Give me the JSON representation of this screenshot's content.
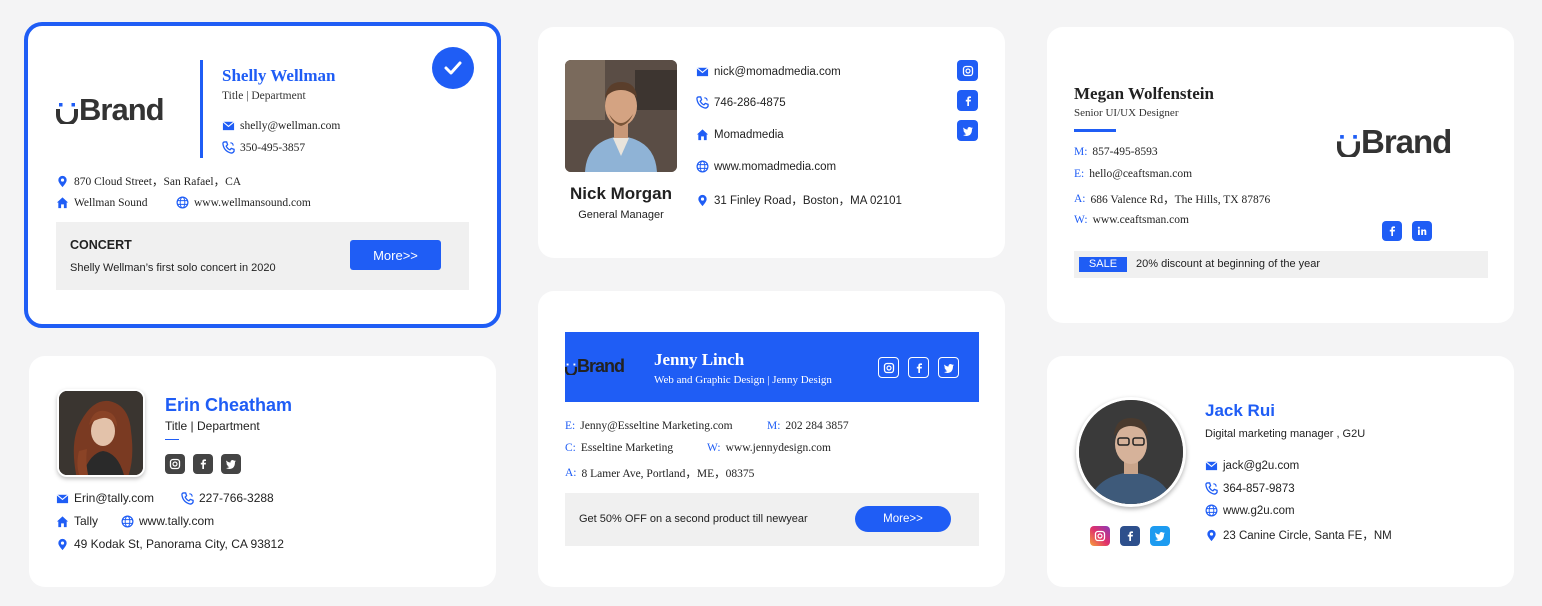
{
  "card1": {
    "brand": "Brand",
    "name": "Shelly Wellman",
    "title": "Title | Department",
    "email": "shelly@wellman.com",
    "phone": "350-495-3857",
    "address": "870 Cloud Street，San Rafael，CA",
    "company": "Wellman Sound",
    "website": "www.wellmansound.com",
    "banner_title": "CONCERT",
    "banner_text": "Shelly Wellman’s first solo concert in 2020",
    "button": "More>>"
  },
  "card2": {
    "email": "nick@momadmedia.com",
    "phone": "746-286-4875",
    "company": "Momadmedia",
    "website": "www.momadmedia.com",
    "address": "31 Finley Road，Boston，MA 02101",
    "name": "Nick Morgan",
    "role": "General Manager"
  },
  "card3": {
    "name": "Megan Wolfenstein",
    "role": "Senior UI/UX Designer",
    "m_label": "M:",
    "m_value": "857-495-8593",
    "e_label": "E:",
    "e_value": "hello@ceaftsman.com",
    "a_label": "A:",
    "a_value": "686 Valence Rd，The Hills, TX 87876",
    "w_label": "W:",
    "w_value": "www.ceaftsman.com",
    "brand": "Brand",
    "sale_badge": "SALE",
    "sale_text": "20% discount at beginning of the year"
  },
  "card4": {
    "name": "Erin Cheatham",
    "title": "Title | Department",
    "email": "Erin@tally.com",
    "phone": "227-766-3288",
    "company": "Tally",
    "website": "www.tally.com",
    "address": "49 Kodak St, Panorama City, CA 93812"
  },
  "card5": {
    "brand": "Brand",
    "name": "Jenny Linch",
    "role": "Web and Graphic Design | Jenny Design",
    "e_label": "E:",
    "e_value": "Jenny@Esseltine Marketing.com",
    "m_label": "M:",
    "m_value": "202 284 3857",
    "c_label": "C:",
    "c_value": "Esseltine Marketing",
    "w_label": "W:",
    "w_value": "www.jennydesign.com",
    "a_label": "A:",
    "a_value": "8 Lamer Ave, Portland，ME，08375",
    "banner_text": "Get 50% OFF on a second product till newyear",
    "button": "More>>"
  },
  "card6": {
    "name": "Jack Rui",
    "role": "Digital marketing manager , G2U",
    "email": "jack@g2u.com",
    "phone": "364-857-9873",
    "website": "www.g2u.com",
    "address": "23 Canine Circle, Santa FE，NM"
  },
  "colors": {
    "accent": "#1f5df5",
    "background": "#f4f4f5",
    "card": "#ffffff",
    "banner": "#f0f0f0"
  }
}
